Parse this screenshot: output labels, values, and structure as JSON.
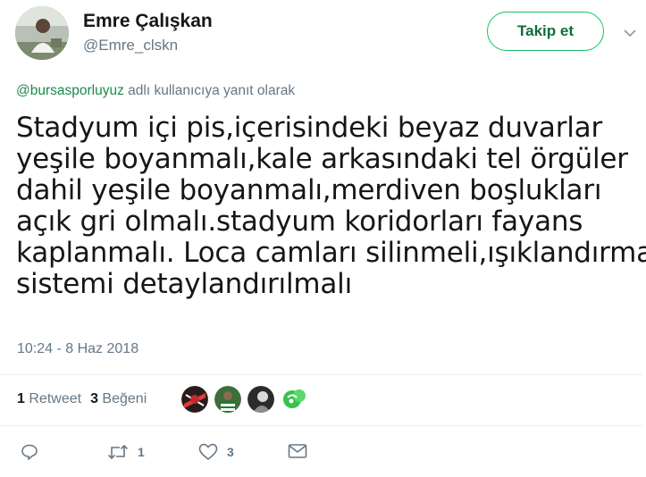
{
  "author": {
    "name": "Emre Çalışkan",
    "handle": "@Emre_clskn",
    "avatar_icon": "avatar-photo"
  },
  "follow_button": {
    "label": "Takip et"
  },
  "reply_context": {
    "mention": "@bursasporluyuz",
    "suffix": " adlı kullanıcıya yanıt olarak"
  },
  "tweet": {
    "lines": [
      "Stadyum içi pis,içerisindeki beyaz duvarlar",
      "yeşile boyanmalı,kale arkasındaki tel örgüler",
      "dahil yeşile boyanmalı,merdiven boşlukları",
      "açık gri olmalı.stadyum koridorları fayans",
      "kaplanmalı. Loca camları silinmeli,ışıklandırma",
      "sistemi detaylandırılmalı"
    ],
    "timestamp": "10:24 - 8 Haz 2018"
  },
  "stats": {
    "retweets_count": "1",
    "retweets_label": "Retweet",
    "likes_count": "3",
    "likes_label": "Beğeni"
  },
  "actions": {
    "reply_icon": "reply-icon",
    "retweet_icon": "retweet-icon",
    "retweet_count": "1",
    "like_icon": "heart-icon",
    "like_count": "3",
    "dm_icon": "envelope-icon"
  },
  "colors": {
    "accent": "#17bf63",
    "mention": "#1b8a4a",
    "muted": "#657786",
    "text": "#14171a"
  }
}
